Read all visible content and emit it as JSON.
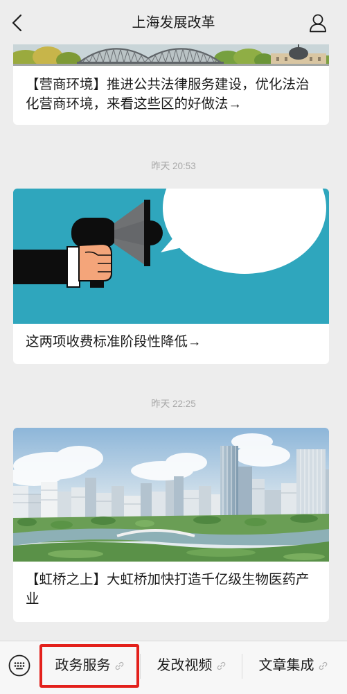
{
  "header": {
    "title": "上海发展改革",
    "back_icon": "chevron-left-icon",
    "profile_icon": "person-icon"
  },
  "feed": {
    "articles": [
      {
        "title": "【营商环境】推进公共法律服务建设，优化法治化营商环境，来看这些区的好做法→"
      },
      {
        "time": "昨天 20:53",
        "title": "这两项收费标准阶段性降低→"
      },
      {
        "time": "昨天 22:25",
        "title": "【虹桥之上】大虹桥加快打造千亿级生物医药产业"
      }
    ]
  },
  "menu_bar": {
    "keyboard_icon": "keyboard-icon",
    "items": [
      {
        "label": "政务服务",
        "icon": "link-icon"
      },
      {
        "label": "发改视频",
        "icon": "link-icon"
      },
      {
        "label": "文章集成",
        "icon": "link-icon"
      }
    ]
  },
  "colors": {
    "background": "#ededed",
    "card": "#ffffff",
    "text": "#191919",
    "timestamp": "#a8a8a8",
    "menu_bar": "#f7f7f7",
    "highlight_border": "#e3201b",
    "illustration_teal": "#2fa6bd"
  }
}
